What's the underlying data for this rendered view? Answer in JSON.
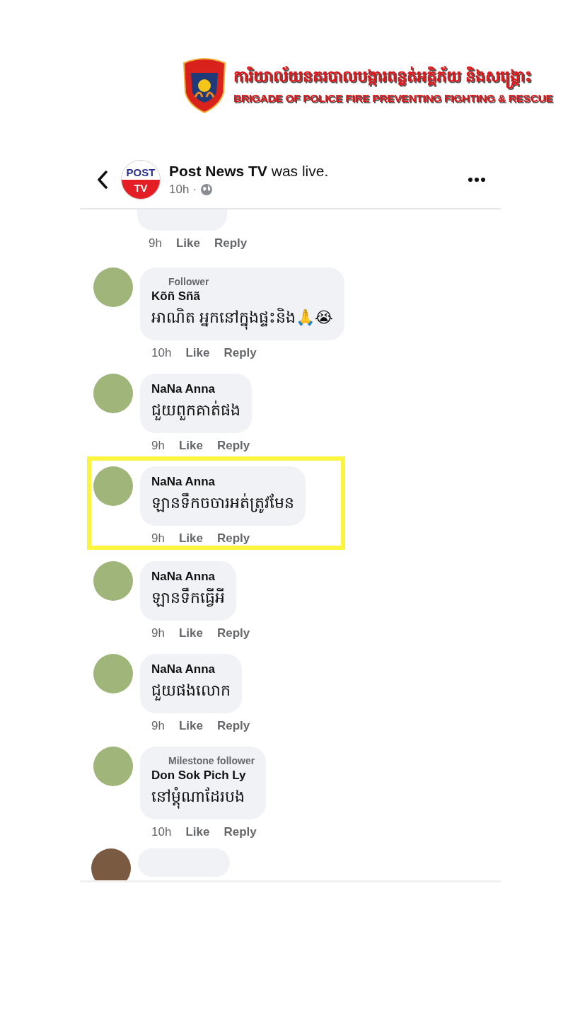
{
  "banner": {
    "title_khmer": "ការិយាល័យនគរបាលបង្ការពន្លត់អគ្គិភ័យ និងសង្គ្រោះ",
    "title_english": "BRIGADE OF POLICE FIRE PREVENTING FIGHTING & RESCUE"
  },
  "post_header": {
    "logo_top": "POST",
    "logo_bottom": "TV",
    "page_name": "Post News TV",
    "action": "was live.",
    "time": "10h",
    "separator": "·"
  },
  "comments": [
    {
      "kind": "cut_top",
      "time": "9h",
      "like": "Like",
      "reply": "Reply"
    },
    {
      "kind": "full",
      "badge": "Follower",
      "author": "Kõñ Sñã",
      "text": "អាណិត អ្នកនៅក្នុងផ្ទះនិង🙏😭",
      "time": "10h",
      "like": "Like",
      "reply": "Reply",
      "highlighted": false
    },
    {
      "kind": "full",
      "author": "NaNa Anna",
      "text": "ជួយពួកគាត់ផង",
      "time": "9h",
      "like": "Like",
      "reply": "Reply",
      "highlighted": false
    },
    {
      "kind": "full",
      "author": "NaNa Anna",
      "text": "ឡានទឹកចចារអត់ត្រូវមែន",
      "time": "9h",
      "like": "Like",
      "reply": "Reply",
      "highlighted": true
    },
    {
      "kind": "full",
      "author": "NaNa Anna",
      "text": "ឡានទឹកធ្វើអី",
      "time": "9h",
      "like": "Like",
      "reply": "Reply",
      "highlighted": false
    },
    {
      "kind": "full",
      "author": "NaNa Anna",
      "text": "ជួយផងលោក",
      "time": "9h",
      "like": "Like",
      "reply": "Reply",
      "highlighted": false
    },
    {
      "kind": "full",
      "badge": "Milestone follower",
      "author": "Don Sok Pich Ly",
      "text": "នៅម្តុំណាដែរបង",
      "time": "10h",
      "like": "Like",
      "reply": "Reply",
      "highlighted": false
    },
    {
      "kind": "cut_bottom"
    }
  ]
}
